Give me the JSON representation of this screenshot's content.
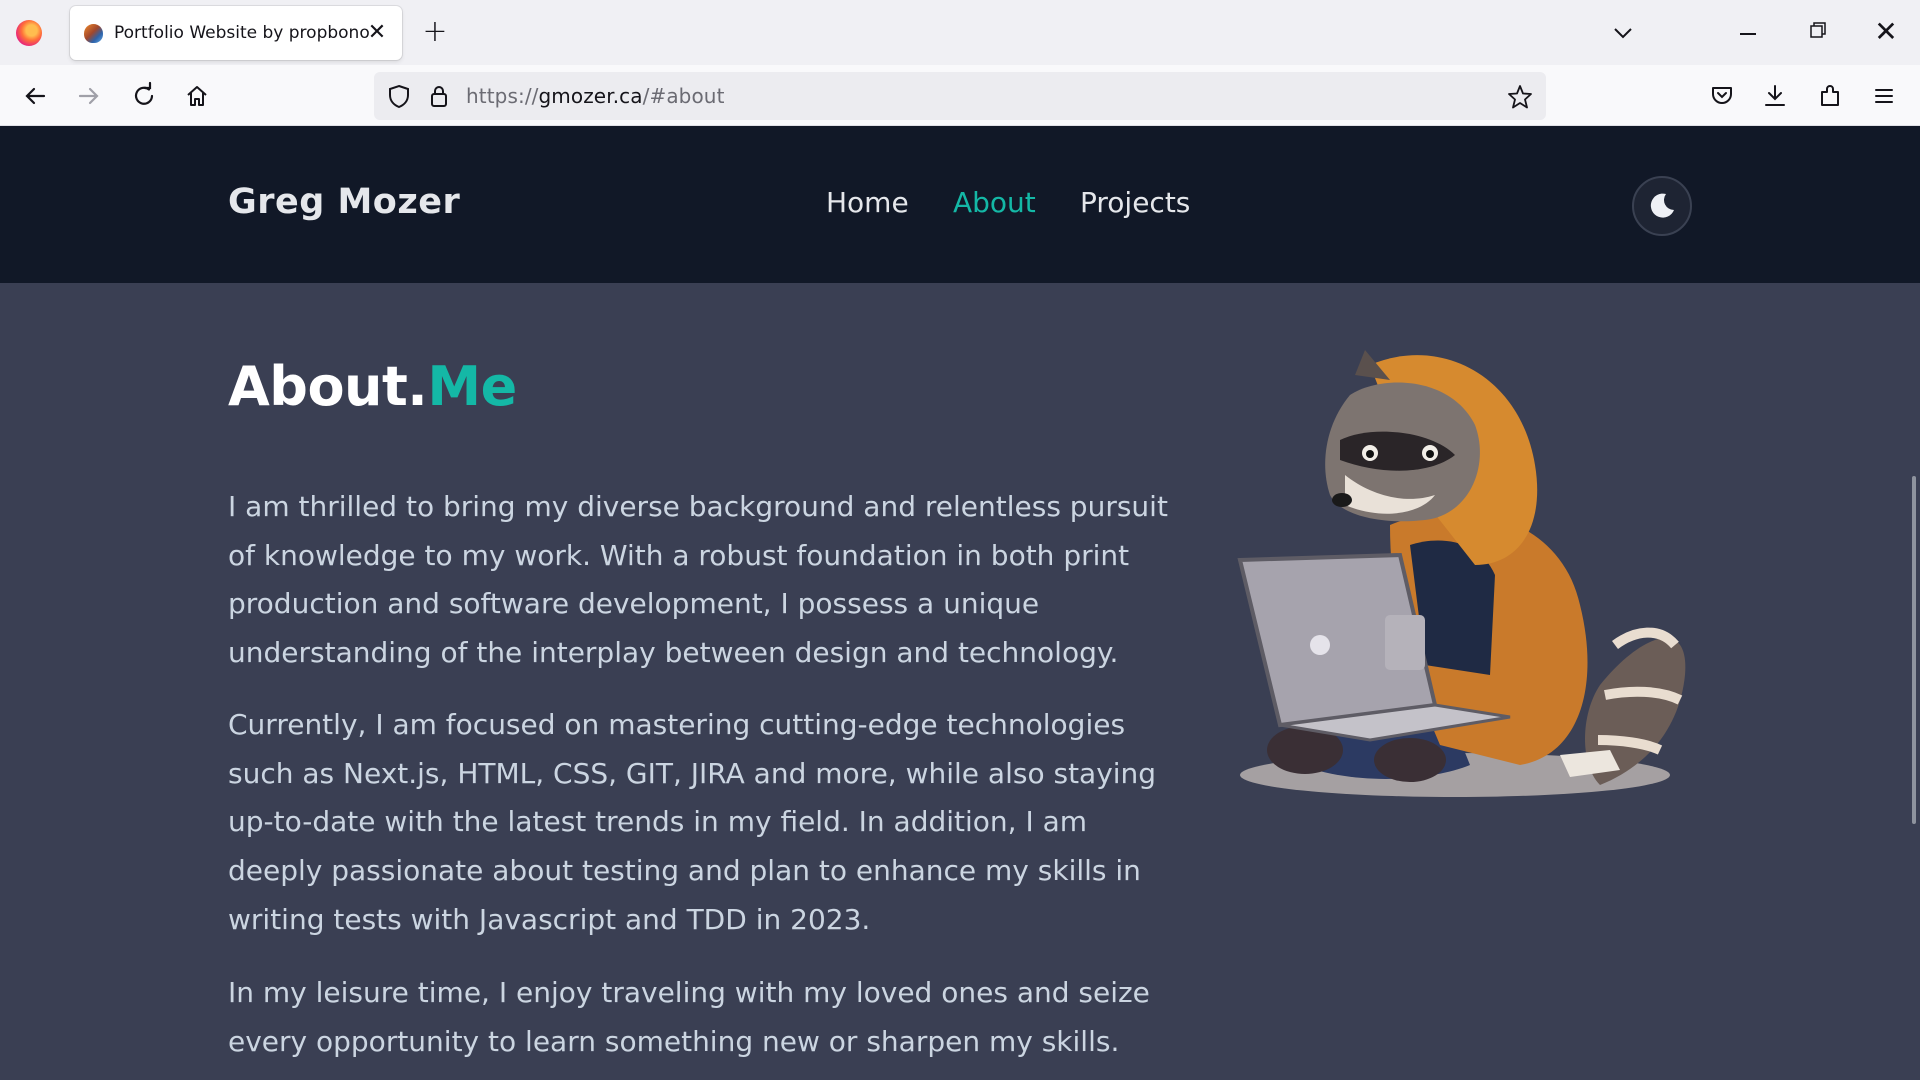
{
  "browser": {
    "tab": {
      "title": "Portfolio Website by propbono",
      "close_icon": "close-icon"
    },
    "new_tab_icon": "plus-icon",
    "tab_list_icon": "chevron-down-icon",
    "window_controls": {
      "minimize_icon": "minimize-icon",
      "restore_icon": "restore-icon",
      "close_icon": "close-icon"
    },
    "nav": {
      "back_icon": "arrow-left-icon",
      "forward_icon": "arrow-right-icon",
      "reload_icon": "reload-icon",
      "home_icon": "home-icon"
    },
    "url": {
      "scheme": "https://",
      "host": "gmozer.ca",
      "path": "/#about"
    },
    "toolbar_icons": [
      "pocket-icon",
      "download-icon",
      "extensions-icon",
      "menu-icon"
    ]
  },
  "site": {
    "brand": "Greg Mozer",
    "nav": [
      {
        "label": "Home",
        "active": false
      },
      {
        "label": "About",
        "active": true
      },
      {
        "label": "Projects",
        "active": false
      }
    ],
    "theme_toggle_icon": "moon-icon",
    "accent_color": "#14b8a6",
    "header_bg": "#111827",
    "content_bg": "#3a3f53"
  },
  "about": {
    "title_main": "About.",
    "title_accent": "Me",
    "paragraphs": [
      [
        "I am thrilled to bring my diverse background and relentless pursuit",
        "of knowledge to my work. With a robust foundation in both print",
        "production and software development, I possess a unique",
        "understanding of the interplay between design and technology."
      ],
      [
        "Currently, I am focused on mastering cutting-edge technologies",
        "such as Next.js, HTML, CSS, GIT, JIRA and more, while also staying",
        "up-to-date with the latest trends in my field. In addition, I am",
        "deeply passionate about testing and plan to enhance my skills in",
        "writing tests with Javascript and TDD in 2023."
      ],
      [
        "In my leisure time, I enjoy traveling with my loved ones and seize",
        "every opportunity to learn something new or sharpen my skills."
      ]
    ],
    "illustration": "raccoon-with-laptop-illustration"
  }
}
